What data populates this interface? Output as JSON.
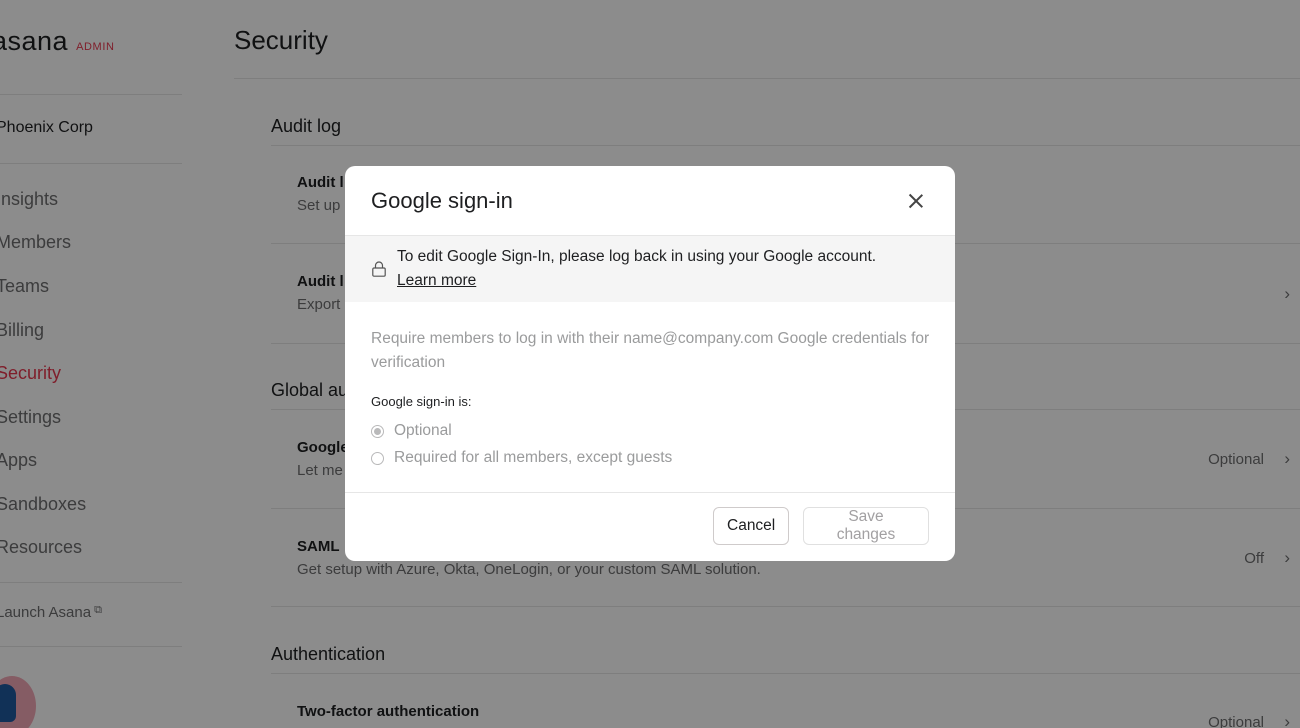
{
  "sidebar": {
    "logo": {
      "word": "asana",
      "tag": "ADMIN"
    },
    "org_name": "Phoenix Corp",
    "items": [
      {
        "label": "Insights"
      },
      {
        "label": "Members"
      },
      {
        "label": "Teams"
      },
      {
        "label": "Billing"
      },
      {
        "label": "Security"
      },
      {
        "label": "Settings"
      },
      {
        "label": "Apps"
      },
      {
        "label": "Sandboxes"
      },
      {
        "label": "Resources"
      }
    ],
    "external_link": "Launch Asana"
  },
  "main": {
    "title": "Security",
    "sections": [
      {
        "heading": "Audit log",
        "rows": [
          {
            "title": "Audit l",
            "desc": "Set up"
          },
          {
            "title": "Audit l",
            "desc": "Export"
          }
        ]
      },
      {
        "heading": "Global au",
        "rows": [
          {
            "title": "Google",
            "desc": "Let me",
            "value": "Optional"
          },
          {
            "title": "SAML",
            "desc": "Get setup with Azure, Okta, OneLogin, or your custom SAML solution.",
            "value": "Off"
          }
        ]
      },
      {
        "heading": "Authentication",
        "rows": [
          {
            "title": "Two-factor authentication",
            "value": "Optional"
          }
        ]
      }
    ]
  },
  "modal": {
    "title": "Google sign-in",
    "notice": {
      "text": "To edit Google Sign-In, please log back in using your Google account.",
      "link": "Learn more"
    },
    "description": "Require members to log in with their name@company.com Google credentials for verification",
    "field_label": "Google sign-in is:",
    "options": [
      {
        "label": "Optional",
        "checked": true
      },
      {
        "label": "Required for all members, except guests",
        "checked": false
      }
    ],
    "cancel_label": "Cancel",
    "save_label": "Save changes"
  },
  "colors": {
    "accent": "#e8384f",
    "overlay": "rgba(0,0,0,0.45)",
    "muted_text": "#6d6e6f"
  }
}
